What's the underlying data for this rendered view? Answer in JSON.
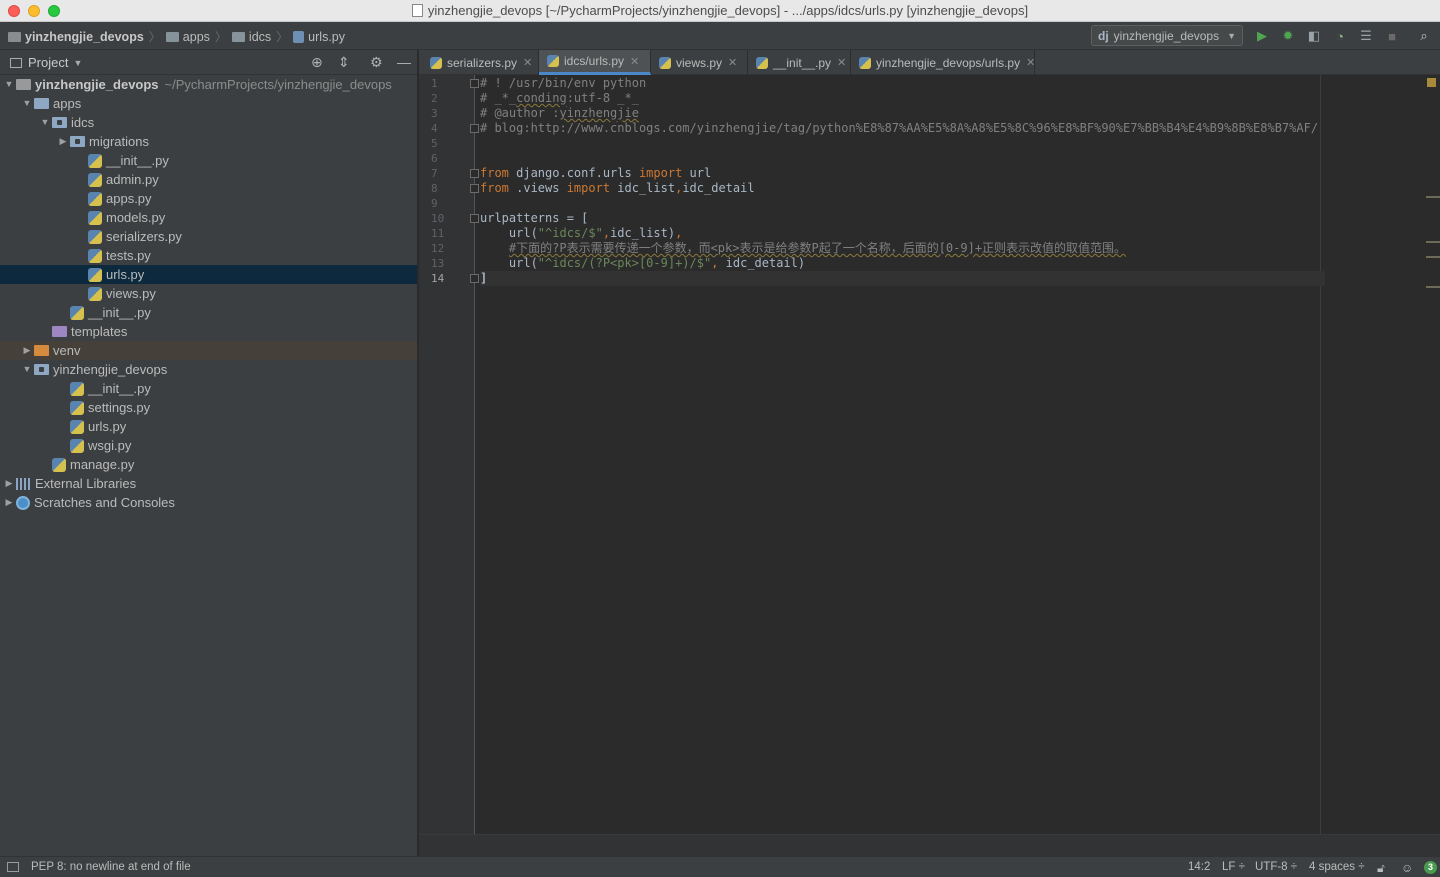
{
  "window": {
    "title": "yinzhengjie_devops [~/PycharmProjects/yinzhengjie_devops] - .../apps/idcs/urls.py [yinzhengjie_devops]"
  },
  "breadcrumb": [
    "yinzhengjie_devops",
    "apps",
    "idcs",
    "urls.py"
  ],
  "toolbar": {
    "run_config_prefix": "dj",
    "run_config": "yinzhengjie_devops",
    "icons": [
      "run-icon",
      "debug-icon",
      "coverage-icon",
      "profile-icon",
      "concurrency-icon",
      "stop-icon",
      "search-icon"
    ]
  },
  "project_panel": {
    "title": "Project",
    "tree": [
      {
        "label": "yinzhengjie_devops",
        "extra": "~/PycharmProjects/yinzhengjie_devops",
        "depth": 0,
        "arrow": "down",
        "icon": "folder-grey",
        "bold": true
      },
      {
        "label": "apps",
        "depth": 1,
        "arrow": "down",
        "icon": "folder"
      },
      {
        "label": "idcs",
        "depth": 2,
        "arrow": "down",
        "icon": "folder-pkg"
      },
      {
        "label": "migrations",
        "depth": 3,
        "arrow": "right",
        "icon": "folder-pkg"
      },
      {
        "label": "__init__.py",
        "depth": 4,
        "icon": "py"
      },
      {
        "label": "admin.py",
        "depth": 4,
        "icon": "py"
      },
      {
        "label": "apps.py",
        "depth": 4,
        "icon": "py"
      },
      {
        "label": "models.py",
        "depth": 4,
        "icon": "py"
      },
      {
        "label": "serializers.py",
        "depth": 4,
        "icon": "py"
      },
      {
        "label": "tests.py",
        "depth": 4,
        "icon": "py"
      },
      {
        "label": "urls.py",
        "depth": 4,
        "icon": "py",
        "selected": true
      },
      {
        "label": "views.py",
        "depth": 4,
        "icon": "py"
      },
      {
        "label": "__init__.py",
        "depth": 3,
        "icon": "py"
      },
      {
        "label": "templates",
        "depth": 2,
        "icon": "folder-purple"
      },
      {
        "label": "venv",
        "depth": 1,
        "arrow": "right",
        "icon": "folder-orange",
        "highlight": true
      },
      {
        "label": "yinzhengjie_devops",
        "depth": 1,
        "arrow": "down",
        "icon": "folder-pkg"
      },
      {
        "label": "__init__.py",
        "depth": 3,
        "icon": "py"
      },
      {
        "label": "settings.py",
        "depth": 3,
        "icon": "py"
      },
      {
        "label": "urls.py",
        "depth": 3,
        "icon": "py"
      },
      {
        "label": "wsgi.py",
        "depth": 3,
        "icon": "py"
      },
      {
        "label": "manage.py",
        "depth": 2,
        "icon": "py"
      },
      {
        "label": "External Libraries",
        "depth": 0,
        "arrow": "right",
        "icon": "libs"
      },
      {
        "label": "Scratches and Consoles",
        "depth": 0,
        "arrow": "right",
        "icon": "scratch"
      }
    ]
  },
  "tabs": [
    {
      "label": "serializers.py",
      "active": false
    },
    {
      "label": "idcs/urls.py",
      "active": true
    },
    {
      "label": "views.py",
      "active": false
    },
    {
      "label": "__init__.py",
      "active": false
    },
    {
      "label": "yinzhengjie_devops/urls.py",
      "active": false
    }
  ],
  "editor": {
    "current_line": 14,
    "lines": [
      [
        {
          "t": "# ! /usr/bin/env python",
          "c": "com"
        }
      ],
      [
        {
          "t": "# _*_",
          "c": "com"
        },
        {
          "t": "conding",
          "c": "warn"
        },
        {
          "t": ":utf-8 _*_",
          "c": "com"
        }
      ],
      [
        {
          "t": "# @author :",
          "c": "com"
        },
        {
          "t": "yinzhengjie",
          "c": "warn"
        }
      ],
      [
        {
          "t": "# blog:http://www.cnblogs.com/yinzhengjie/tag/python%E8%87%AA%E5%8A%A8%E5%8C%96%E8%BF%90%E7%BB%B4%E4%B9%8B%E8%B7%AF/",
          "c": "com"
        }
      ],
      [],
      [],
      [
        {
          "t": "from",
          "c": "kw"
        },
        {
          "t": " django.conf.urls "
        },
        {
          "t": "import",
          "c": "kw"
        },
        {
          "t": " url"
        }
      ],
      [
        {
          "t": "from",
          "c": "kw"
        },
        {
          "t": " .views "
        },
        {
          "t": "import",
          "c": "kw"
        },
        {
          "t": " idc_list"
        },
        {
          "t": ",",
          "c": "kw"
        },
        {
          "t": "idc_detail"
        }
      ],
      [],
      [
        {
          "t": "urlpatterns = ["
        }
      ],
      [
        {
          "t": "    url("
        },
        {
          "t": "\"^",
          "c": "str"
        },
        {
          "t": "idcs",
          "c": "str"
        },
        {
          "t": "/$\"",
          "c": "str"
        },
        {
          "t": ",",
          "c": "kw"
        },
        {
          "t": "idc_list)"
        },
        {
          "t": ",",
          "c": "kw"
        }
      ],
      [
        {
          "t": "    "
        },
        {
          "t": "#下面的?P表示需要传递一个参数，而<pk>表示是给参数P起了一个名称，后面的[0-9]+正则表示改值的取值范围。",
          "c": "warn"
        }
      ],
      [
        {
          "t": "    url("
        },
        {
          "t": "\"^idcs/(?P<pk>[0-9]+)/$\"",
          "c": "str"
        },
        {
          "t": ",",
          "c": "kw"
        },
        {
          "t": " idc_detail)"
        }
      ],
      [
        {
          "t": "]",
          "c": "bold"
        }
      ]
    ]
  },
  "status_bar": {
    "message": "PEP 8: no newline at end of file",
    "position": "14:2",
    "line_separator": "LF ÷",
    "encoding": "UTF-8 ÷",
    "indent": "4 spaces ÷",
    "notifications": "3"
  }
}
